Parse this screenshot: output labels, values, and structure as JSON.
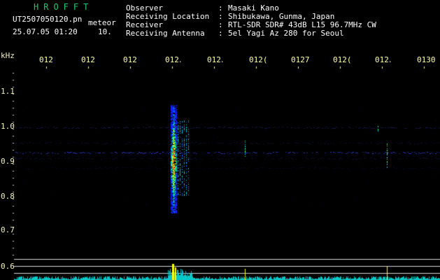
{
  "header": {
    "brand": "HROFFT",
    "filename": "UT2507050120.pn",
    "mode": "meteor",
    "datetime": "25.07.05 01:20",
    "count": "10.",
    "fields": [
      {
        "label": "Observer",
        "sep": ":",
        "value": "Masaki Kano"
      },
      {
        "label": "Receiving Location",
        "sep": ":",
        "value": "Shibukawa, Gunma, Japan"
      },
      {
        "label": "Receiver",
        "sep": ":",
        "value": "RTL-SDR SDR# 43dB L15 96.7MHz CW"
      },
      {
        "label": "Receiving Antenna",
        "sep": ":",
        "value": "5el Yagi Az 280 for Seoul"
      }
    ]
  },
  "axes": {
    "y_unit": "kHz",
    "y_ticks": [
      "1.1",
      "1.0",
      "0.9",
      "0.8",
      "0.7",
      "0.6"
    ],
    "time_ticks": [
      "012",
      "012",
      "012",
      "012․",
      "012․",
      "012(",
      "0127",
      "012(",
      "012․",
      "0130"
    ]
  },
  "colors": {
    "background": "#000000",
    "header_green": "#22c86a",
    "header_text": "#ffffff",
    "tick_text": "#ffffa0",
    "grid_line": "#ffffff",
    "band_line": "#3344ff",
    "spectrum": "#00c8c8",
    "peak": "#ffff00"
  }
}
